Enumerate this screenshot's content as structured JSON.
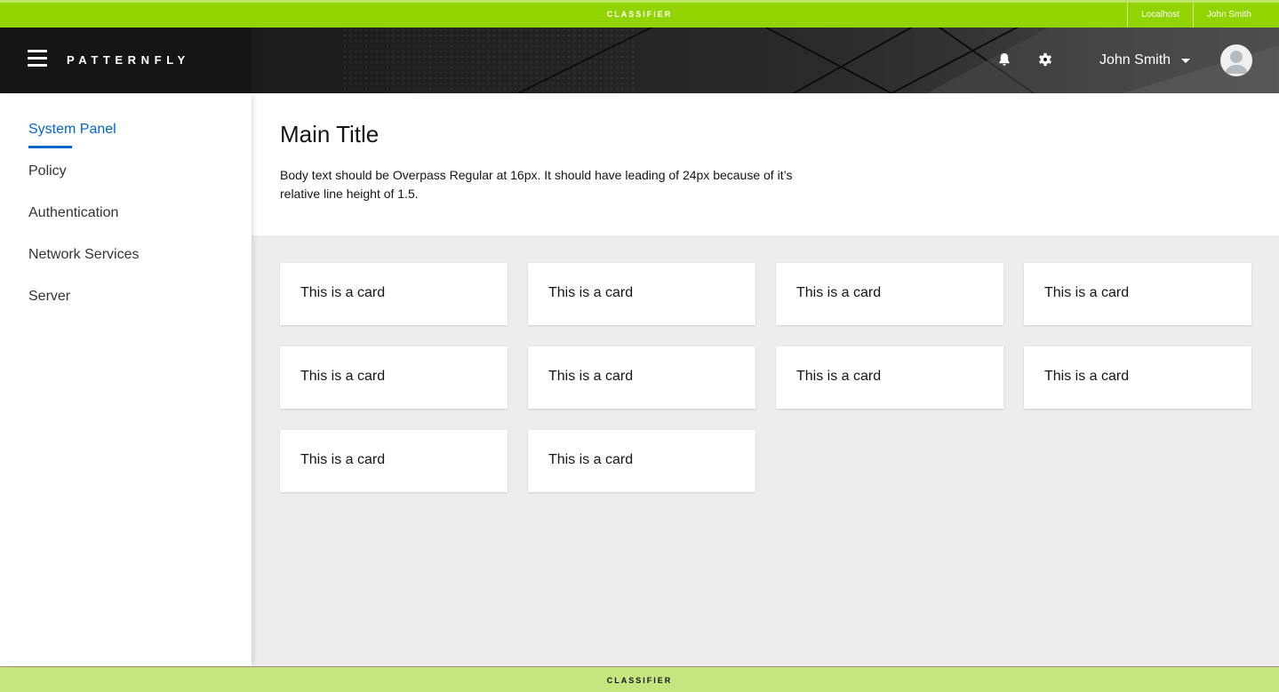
{
  "classification": {
    "top_label": "CLASSIFIER",
    "bottom_label": "CLASSIFIER",
    "host": "Localhost",
    "user": "John Smith",
    "top_color": "#92d400",
    "bottom_color": "#c5e67f"
  },
  "masthead": {
    "menu_icon": "hamburger-icon",
    "brand": "PATTERNFLY",
    "notifications_icon": "bell-icon",
    "settings_icon": "gear-icon",
    "user_name": "John Smith",
    "user_caret_icon": "caret-down-icon",
    "avatar_icon": "user-avatar-icon"
  },
  "sidebar": {
    "items": [
      {
        "label": "System Panel",
        "active": true
      },
      {
        "label": "Policy",
        "active": false
      },
      {
        "label": "Authentication",
        "active": false
      },
      {
        "label": "Network Services",
        "active": false
      },
      {
        "label": "Server",
        "active": false
      }
    ]
  },
  "main": {
    "title": "Main Title",
    "body": "Body text should be Overpass Regular at 16px. It should have leading of 24px because of it’s relative line height of 1.5.",
    "cards": [
      "This is a card",
      "This is a card",
      "This is a card",
      "This is a card",
      "This is a card",
      "This is a card",
      "This is a card",
      "This is a card",
      "This is a card",
      "This is a card"
    ]
  },
  "colors": {
    "accent": "#0066cc",
    "masthead_bg": "#151515",
    "gallery_bg": "#ededed"
  }
}
